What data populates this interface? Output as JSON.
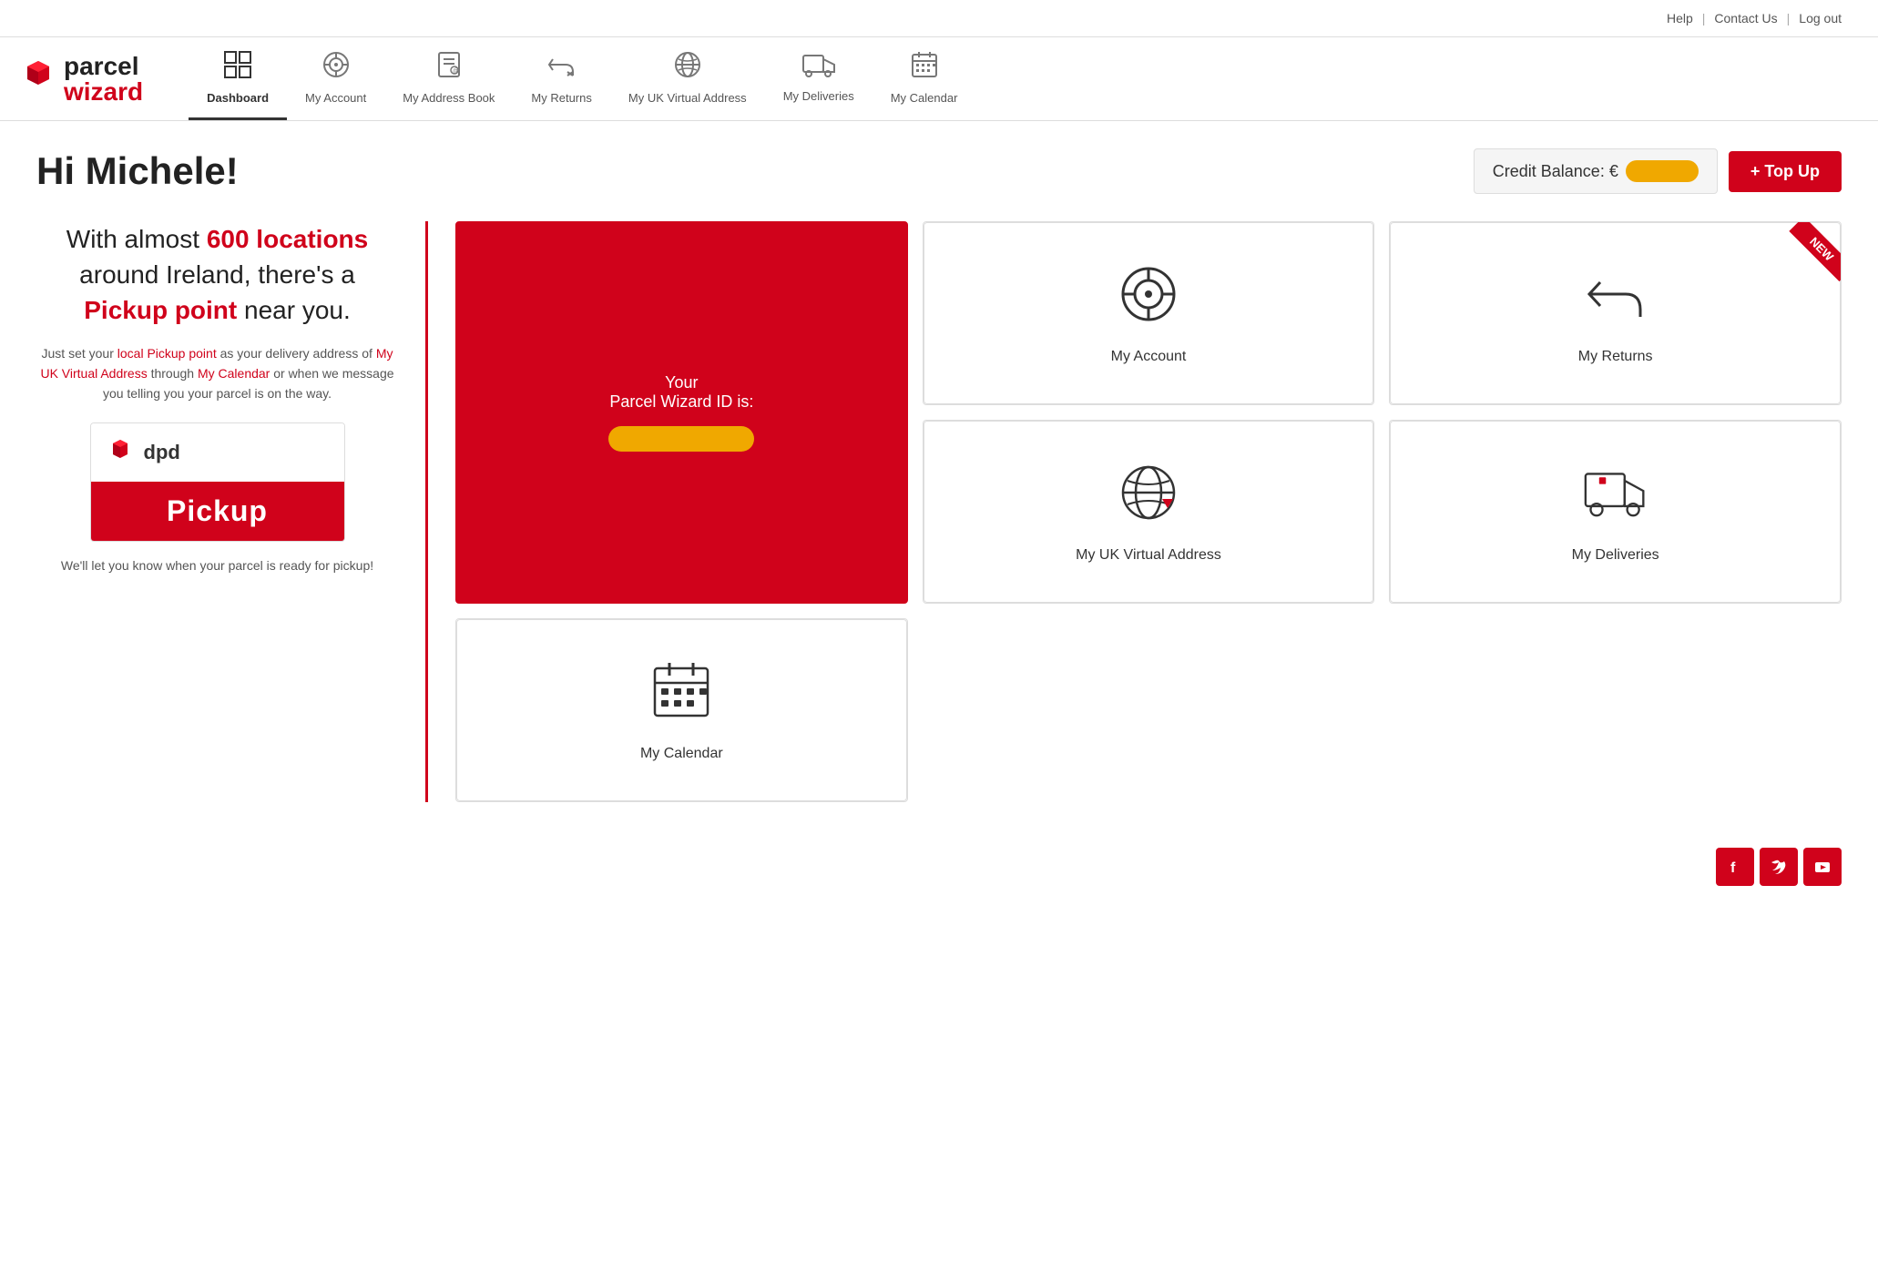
{
  "topnav": {
    "help": "Help",
    "sep1": "|",
    "contact": "Contact Us",
    "sep2": "|",
    "logout": "Log out"
  },
  "nav": {
    "brand_line1": "parcel",
    "brand_line2": "wizard",
    "items": [
      {
        "id": "dashboard",
        "label": "Dashboard",
        "active": true
      },
      {
        "id": "my-account",
        "label": "My Account",
        "active": false
      },
      {
        "id": "my-address-book",
        "label": "My Address Book",
        "active": false
      },
      {
        "id": "my-returns",
        "label": "My Returns",
        "active": false
      },
      {
        "id": "my-uk-virtual-address",
        "label": "My UK Virtual Address",
        "active": false
      },
      {
        "id": "my-deliveries",
        "label": "My Deliveries",
        "active": false
      },
      {
        "id": "my-calendar",
        "label": "My Calendar",
        "active": false
      }
    ]
  },
  "header": {
    "greeting": "Hi Michele!",
    "credit_label": "Credit Balance: €",
    "topup_label": "+ Top Up"
  },
  "left_panel": {
    "heading_part1": "With almost ",
    "heading_highlight1": "600 locations",
    "heading_part2": " around Ireland, there's a ",
    "heading_highlight2": "Pickup point",
    "heading_part3": " near you.",
    "sub_part1": "Just set your ",
    "sub_link1": "local Pickup point",
    "sub_part2": " as your delivery address of ",
    "sub_link2": "My UK Virtual Address",
    "sub_part3": " through ",
    "sub_link3": "My Calendar",
    "sub_part4": " or when we message you telling you your parcel is on the way.",
    "dpd_name": "dpd",
    "pickup_label": "Pickup",
    "note": "We'll let you know when your parcel is ready for pickup!"
  },
  "right_grid": {
    "parcel_id_title": "Your\nParcel Wizard ID is:",
    "cards": [
      {
        "id": "my-account",
        "label": "My Account",
        "has_new": false
      },
      {
        "id": "my-returns",
        "label": "My Returns",
        "has_new": true
      },
      {
        "id": "my-uk-virtual-address",
        "label": "My UK Virtual Address",
        "has_new": false
      },
      {
        "id": "my-deliveries",
        "label": "My Deliveries",
        "has_new": false
      },
      {
        "id": "my-calendar",
        "label": "My Calendar",
        "has_new": false
      }
    ]
  },
  "footer": {
    "facebook": "f",
    "twitter": "🐦",
    "youtube": "▶"
  },
  "colors": {
    "brand_red": "#d0021b",
    "orange": "#f0a800"
  }
}
